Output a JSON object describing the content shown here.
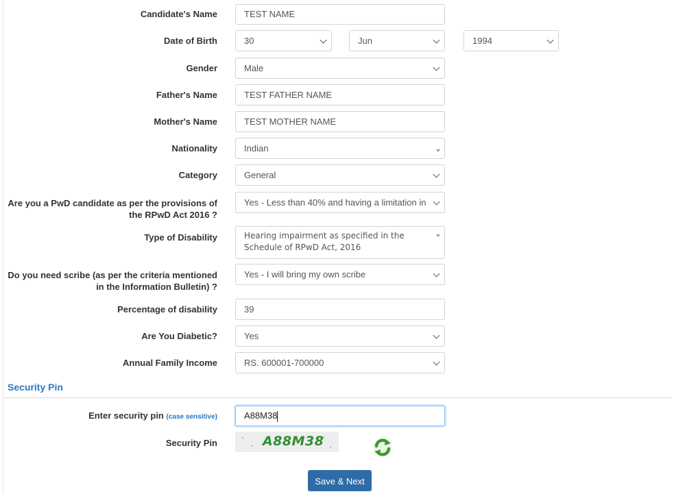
{
  "form": {
    "candidate_name": {
      "label": "Candidate's Name",
      "value": "TEST NAME"
    },
    "dob": {
      "label": "Date of Birth",
      "day": "30",
      "month": "Jun",
      "year": "1994"
    },
    "gender": {
      "label": "Gender",
      "value": "Male"
    },
    "father_name": {
      "label": "Father's Name",
      "value": "TEST FATHER NAME"
    },
    "mother_name": {
      "label": "Mother's Name",
      "value": "TEST MOTHER NAME"
    },
    "nationality": {
      "label": "Nationality",
      "value": "Indian"
    },
    "category": {
      "label": "Category",
      "value": "General"
    },
    "pwd": {
      "label_line1": "Are you a PwD candidate as per the provisions of",
      "label_line2": "the RPwD Act 2016 ?",
      "value": "Yes - Less than 40% and having a limitation in"
    },
    "disability_type": {
      "label": "Type of Disability",
      "value_line1": "Hearing impairment as specified in the",
      "value_line2": "Schedule of RPwD Act, 2016"
    },
    "scribe": {
      "label_line1": "Do you need scribe (as per the criteria mentioned",
      "label_line2": "in the Information Bulletin) ?",
      "value": "Yes - I will bring my own scribe"
    },
    "disability_percentage": {
      "label": "Percentage of disability",
      "value": "39"
    },
    "diabetic": {
      "label": "Are You Diabetic?",
      "value": "Yes"
    },
    "income": {
      "label": "Annual Family Income",
      "value": "RS. 600001-700000"
    }
  },
  "security": {
    "section_title": "Security Pin",
    "enter_label": "Enter security pin",
    "case_hint": "(case sensitive)",
    "entered_value": "A88M38",
    "pin_label": "Security Pin",
    "captcha_text": "A88M38"
  },
  "actions": {
    "save_next": "Save & Next"
  },
  "icons": {
    "refresh": "refresh-icon",
    "dropdown": "chevron-down-icon"
  },
  "colors": {
    "accent": "#2b78c5",
    "button": "#2e6ca8",
    "captcha_text": "#2f8f2f"
  }
}
